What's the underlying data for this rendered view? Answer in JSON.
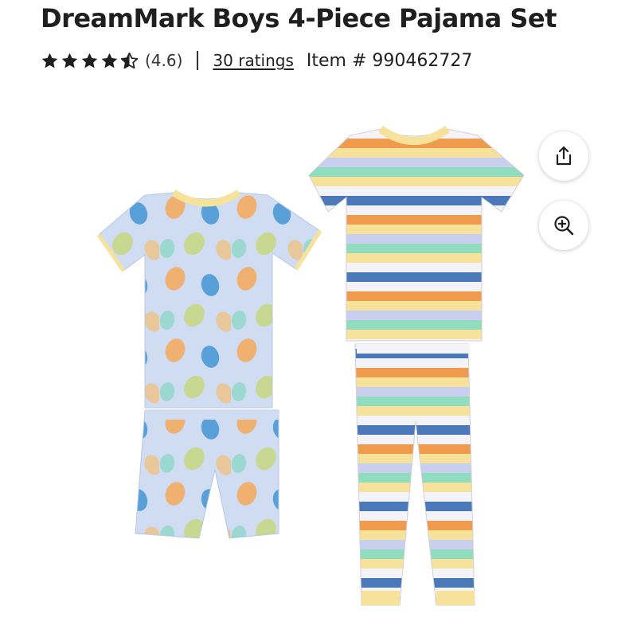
{
  "product": {
    "title": "DreamMark Boys 4-Piece Pajama Set",
    "rating_value": 4.6,
    "rating_text": "(4.6)",
    "ratings_link": "30 ratings",
    "item_number": "Item # 990462727"
  },
  "icons": {
    "share": "share-icon",
    "zoom": "zoom-in-icon",
    "star": "star-icon"
  },
  "colors": {
    "star": "#1f1f1f",
    "text": "#1f1f1f",
    "shirt_blue": "#cfdcf2",
    "stripe_orange": "#ef9a4c",
    "stripe_blue": "#4a78b8",
    "stripe_green": "#8fdcbf",
    "stripe_yellow": "#f6e29a",
    "stripe_lavender": "#c9cfee"
  }
}
